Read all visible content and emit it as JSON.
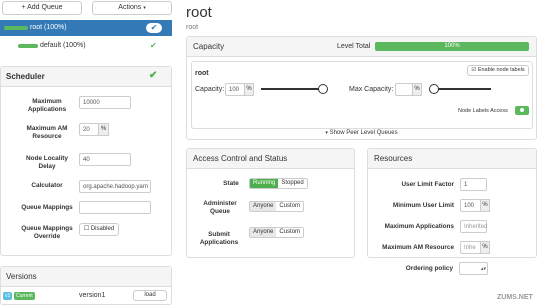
{
  "toolbar": {
    "add_queue_label": "+ Add Queue",
    "actions_label": "Actions"
  },
  "queues": [
    {
      "label": "root (100%)",
      "selected": true
    },
    {
      "label": "default (100%)",
      "selected": false
    }
  ],
  "scheduler": {
    "title": "Scheduler",
    "fields": {
      "max_apps_label": "Maximum Applications",
      "max_apps_value": "10000",
      "max_am_label": "Maximum AM Resource",
      "max_am_value": "20",
      "max_am_unit": "%",
      "locality_label": "Node Locality Delay",
      "locality_value": "40",
      "calculator_label": "Calculator",
      "calculator_value": "org.apache.hadoop.yarn",
      "mappings_label": "Queue Mappings",
      "mappings_value": "",
      "override_label": "Queue Mappings Override",
      "override_value": "Disabled"
    }
  },
  "versions": {
    "title": "Versions",
    "badge_v": "v1",
    "badge_current": "Current",
    "name": "version1",
    "load_label": "load"
  },
  "main": {
    "title": "root",
    "breadcrumb": "root",
    "capacity": {
      "title": "Capacity",
      "level_total_label": "Level Total",
      "level_total_value": "100%",
      "level_total_fraction": 1.0,
      "queue_name": "root",
      "enable_labels_label": "Enable node labels",
      "capacity_label": "Capacity:",
      "capacity_value": "100",
      "capacity_unit": "%",
      "capacity_fraction": 1.0,
      "max_capacity_label": "Max Capacity:",
      "max_capacity_value": "",
      "max_capacity_unit": "%",
      "node_labels_access_label": "Node Labels Access",
      "show_peers_label": "Show Peer Level Queues"
    },
    "acl": {
      "title": "Access Control and Status",
      "state_label": "State",
      "state_running": "Running",
      "state_stopped": "Stopped",
      "administer_label": "Administer Queue",
      "submit_label": "Submit Applications",
      "anyone": "Anyone",
      "custom": "Custom"
    },
    "resources": {
      "title": "Resources",
      "user_limit_factor_label": "User Limit Factor",
      "user_limit_factor_value": "1",
      "min_user_limit_label": "Minimum User Limit",
      "min_user_limit_value": "100",
      "min_user_limit_unit": "%",
      "max_apps_label": "Maximum Applications",
      "max_apps_value": "Inherited",
      "max_am_label": "Maximum AM Resource",
      "max_am_value": "Inhe",
      "max_am_unit": "%",
      "ordering_label": "Ordering policy",
      "ordering_value": ""
    }
  },
  "watermark": "ZUMS.NET",
  "colors": {
    "accent_blue": "#337ab7",
    "success_green": "#4cae4c"
  }
}
